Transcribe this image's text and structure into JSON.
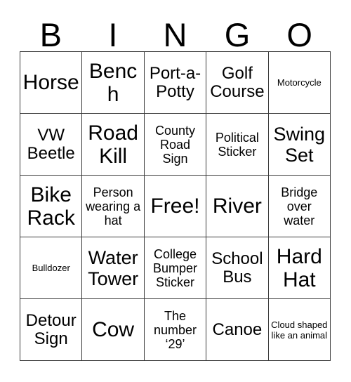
{
  "card": {
    "header_letters": [
      "B",
      "I",
      "N",
      "G",
      "O"
    ],
    "colors": {
      "background": "#ffffff",
      "text": "#000000",
      "grid_line": "#3a3a3a"
    },
    "rows": [
      [
        {
          "text": "Horse",
          "size": "xxl"
        },
        {
          "text": "Bench",
          "size": "xxl"
        },
        {
          "text": "Port-a-Potty",
          "size": "l"
        },
        {
          "text": "Golf Course",
          "size": "l"
        },
        {
          "text": "Motorcycle",
          "size": "xxs"
        }
      ],
      [
        {
          "text": "VW Beetle",
          "size": "l"
        },
        {
          "text": "Road Kill",
          "size": "xxl"
        },
        {
          "text": "County Road Sign",
          "size": "s"
        },
        {
          "text": "Political Sticker",
          "size": "s"
        },
        {
          "text": "Swing Set",
          "size": "xl"
        }
      ],
      [
        {
          "text": "Bike Rack",
          "size": "xxl"
        },
        {
          "text": "Person wearing a hat",
          "size": "s"
        },
        {
          "text": "Free!",
          "size": "xxl"
        },
        {
          "text": "River",
          "size": "xxl"
        },
        {
          "text": "Bridge over water",
          "size": "s"
        }
      ],
      [
        {
          "text": "Bulldozer",
          "size": "xxs"
        },
        {
          "text": "Water Tower",
          "size": "xl"
        },
        {
          "text": "College Bumper Sticker",
          "size": "s"
        },
        {
          "text": "School Bus",
          "size": "l"
        },
        {
          "text": "Hard Hat",
          "size": "xxl"
        }
      ],
      [
        {
          "text": "Detour Sign",
          "size": "l"
        },
        {
          "text": "Cow",
          "size": "xxl"
        },
        {
          "text": "The number ‘29’",
          "size": "s"
        },
        {
          "text": "Canoe",
          "size": "l"
        },
        {
          "text": "Cloud shaped like an animal",
          "size": "xxs"
        }
      ]
    ]
  }
}
